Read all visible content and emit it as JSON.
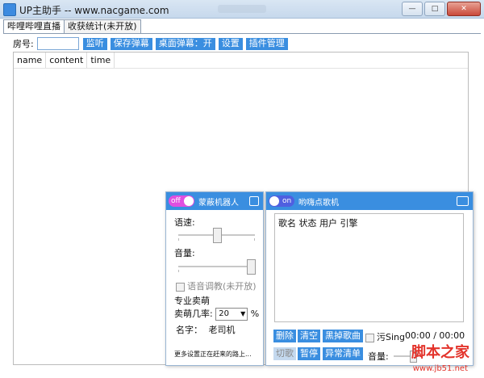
{
  "window": {
    "title": "UP主助手 -- www.nacgame.com",
    "min_label": "—",
    "max_label": "□",
    "close_label": "✕"
  },
  "tabs": [
    {
      "label": "哔哩哔哩直播"
    },
    {
      "label": "收获统计(未开放)"
    }
  ],
  "toolbar": {
    "room_label": "房号:",
    "room_value": "",
    "buttons": [
      "监听",
      "保存弹幕",
      "桌面弹幕：开",
      "设置",
      "插件管理"
    ]
  },
  "table": {
    "columns": [
      "name",
      "content",
      "time"
    ]
  },
  "robot_panel": {
    "toggle": "off",
    "title": "蒙蔽机器人",
    "speed_label": "语速:",
    "volume_label": "音量:",
    "voice_tune_label": "语音调教(未开放)",
    "section_label": "专业卖萌",
    "rate_label": "卖萌几率:",
    "rate_value": "20",
    "rate_unit": "%",
    "name_label": "名字：",
    "name_value": "老司机",
    "footer": "更多设置正在赶来的路上...",
    "speed_level": 0.5,
    "volume_level": 1.0
  },
  "music_panel": {
    "toggle": "on",
    "title": "哟嗨点歌机",
    "list_header": "歌名 状态 用户 引擎",
    "buttons_row1": [
      "删除",
      "清空",
      "黑掉歌曲"
    ],
    "sing_label": "污Sing",
    "time": "00:00 / 00:00",
    "buttons_row2": [
      "切歌",
      "暂停",
      "异常清单"
    ],
    "volume_label": "音量:"
  },
  "watermark": {
    "main": "脚本之家",
    "url": "www.jb51.net"
  },
  "colors": {
    "accent": "#3a8ee0",
    "toggle_off": "#e04fe0",
    "toggle_on": "#4f5fe0"
  }
}
